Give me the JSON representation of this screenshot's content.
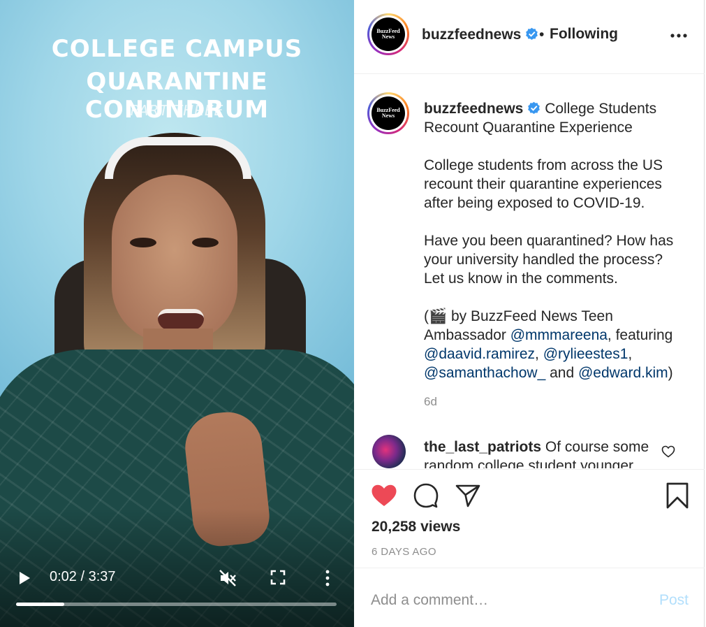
{
  "video": {
    "title_line1": "COLLEGE CAMPUS",
    "title_line2": "QUARANTINE CONUNDRUM",
    "subtitle": "PART THREE",
    "time": "0:02 / 3:37",
    "progress_fraction": 0.15
  },
  "header": {
    "avatar_text": "BuzzFeed News",
    "username": "buzzfeednews",
    "separator": "•",
    "following": "Following"
  },
  "caption": {
    "username": "buzzfeednews",
    "title": "College Students Recount Quarantine Experience",
    "para1": "College students from across the US recount their quarantine experiences after being exposed to COVID-19.",
    "para2": "Have you been quarantined? How has your university handled the process? Let us know in the comments.",
    "credit_prefix": "(🎬 by BuzzFeed News Teen Ambassador ",
    "mention1": "@mmmareena",
    "credit_mid": ", featuring ",
    "mention2": "@daavid.ramirez",
    "sep1": ", ",
    "mention3": "@rylieestes1",
    "sep2": ", ",
    "mention4": "@samanthachow_",
    "and": " and ",
    "mention5": "@edward.kim",
    "close": ")",
    "age": "6d"
  },
  "comment": {
    "username": "the_last_patriots",
    "text": "Of course some random college student younger"
  },
  "actions": {
    "views": "20,258 views",
    "age": "6 DAYS AGO"
  },
  "add_comment": {
    "placeholder": "Add a comment…",
    "post": "Post"
  },
  "colors": {
    "like": "#ed4956",
    "mention": "#00376b",
    "verified": "#3897f0",
    "post_disabled": "#b2dffc"
  }
}
